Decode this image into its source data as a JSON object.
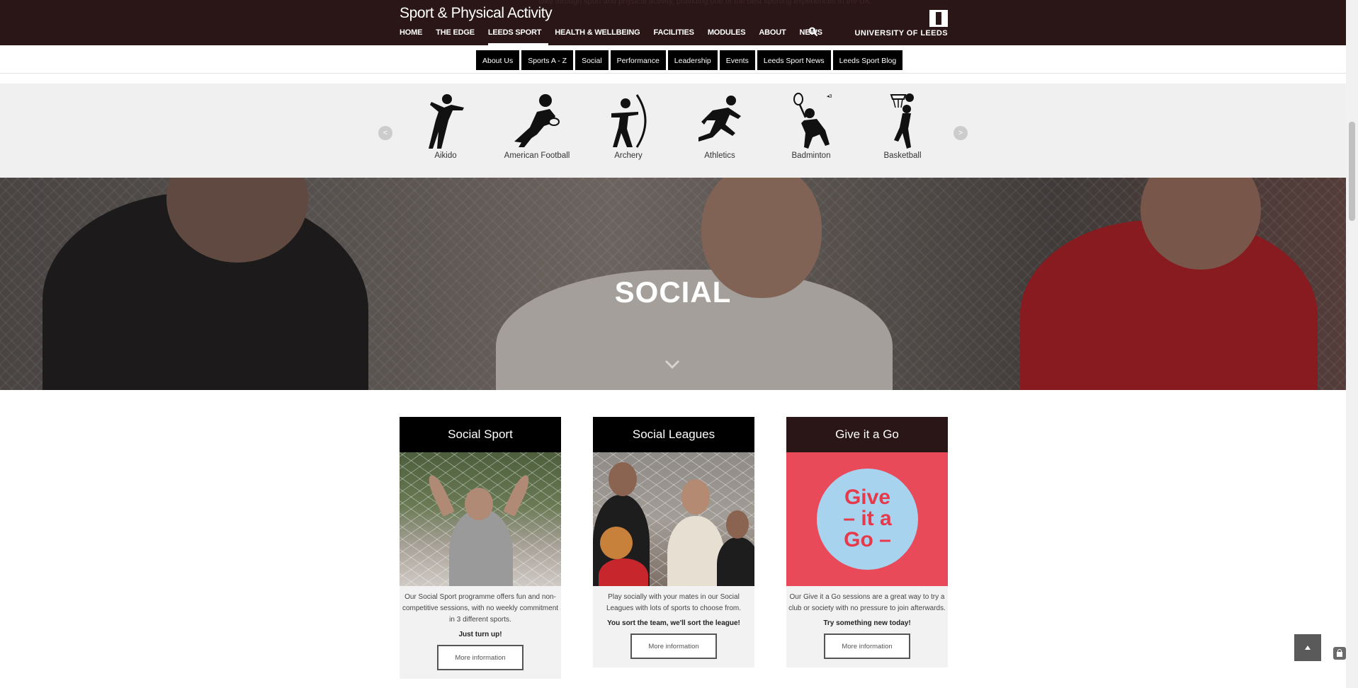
{
  "header": {
    "site_title": "Sport & Physical Activity",
    "ghost_text": "take through sport and physical activity, providing one of the best sporting experiences in the UK.",
    "nav": [
      "HOME",
      "THE EDGE",
      "LEEDS SPORT",
      "HEALTH & WELLBEING",
      "FACILITIES",
      "MODULES",
      "ABOUT",
      "NEWS"
    ],
    "active_nav": "LEEDS SPORT",
    "logo_text": "UNIVERSITY OF LEEDS"
  },
  "subnav": {
    "tabs": [
      "About Us",
      "Sports A - Z",
      "Social",
      "Performance",
      "Leadership",
      "Events",
      "Leeds Sport News",
      "Leeds Sport Blog"
    ]
  },
  "carousel": {
    "prev": "<",
    "next": ">",
    "sports": [
      "Aikido",
      "American Football",
      "Archery",
      "Athletics",
      "Badminton",
      "Basketball"
    ]
  },
  "hero": {
    "title": "SOCIAL"
  },
  "cards": [
    {
      "title": "Social Sport",
      "description": "Our Social Sport programme offers fun and non-competitive sessions, with no weekly commitment in 3 different sports.",
      "tagline": "Just turn up!",
      "button": "More information"
    },
    {
      "title": "Social Leagues",
      "description": "Play socially with your mates in our Social Leagues with lots of sports to choose from.",
      "tagline": "You sort the team, we'll sort the league!",
      "button": "More information"
    },
    {
      "title": "Give it a Go",
      "description": "Our Give it a Go sessions are a great way to try a club or society with no pressure to join afterwards.",
      "tagline": "Try something new today!",
      "button": "More information",
      "logo_lines": [
        "Give",
        "– it a",
        "Go –"
      ]
    }
  ],
  "colors": {
    "header_bg": "#2a1617",
    "tab_bg": "#000000",
    "give_pink": "#e94a5a",
    "give_blue": "#a7d3ef"
  }
}
